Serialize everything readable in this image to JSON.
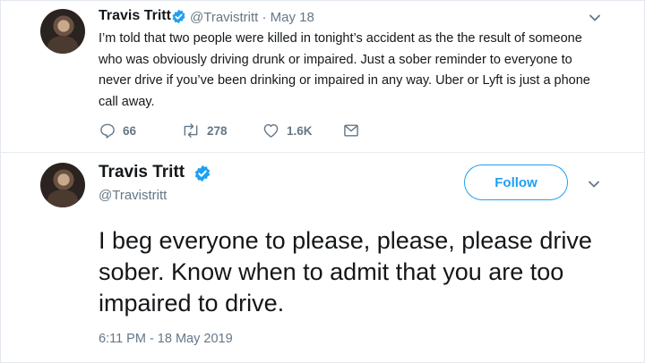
{
  "tweet": {
    "author_name": "Travis Tritt",
    "handle_date": "@Travistritt · May 18",
    "text": "I’m told that two people were killed in tonight’s accident as the the result of someone who was obviously driving drunk or impaired. Just a sober reminder to everyone to never drive if you’ve been drinking or impaired in any way. Uber or Lyft is just a phone call away.",
    "reply_count": "66",
    "retweet_count": "278",
    "like_count": "1.6K"
  },
  "detail": {
    "author_name": "Travis Tritt",
    "handle": "@Travistritt",
    "follow_label": "Follow",
    "text": "I beg everyone to please, please, please drive sober. Know when to admit that you are too impaired to drive.",
    "timestamp": "6:11 PM - 18 May 2019"
  },
  "colors": {
    "accent": "#1da1f2",
    "secondary_text": "#657786",
    "primary_text": "#14171a"
  },
  "icons": [
    "verified-icon",
    "chevron-down-icon",
    "reply-icon",
    "retweet-icon",
    "like-icon",
    "direct-message-icon"
  ]
}
